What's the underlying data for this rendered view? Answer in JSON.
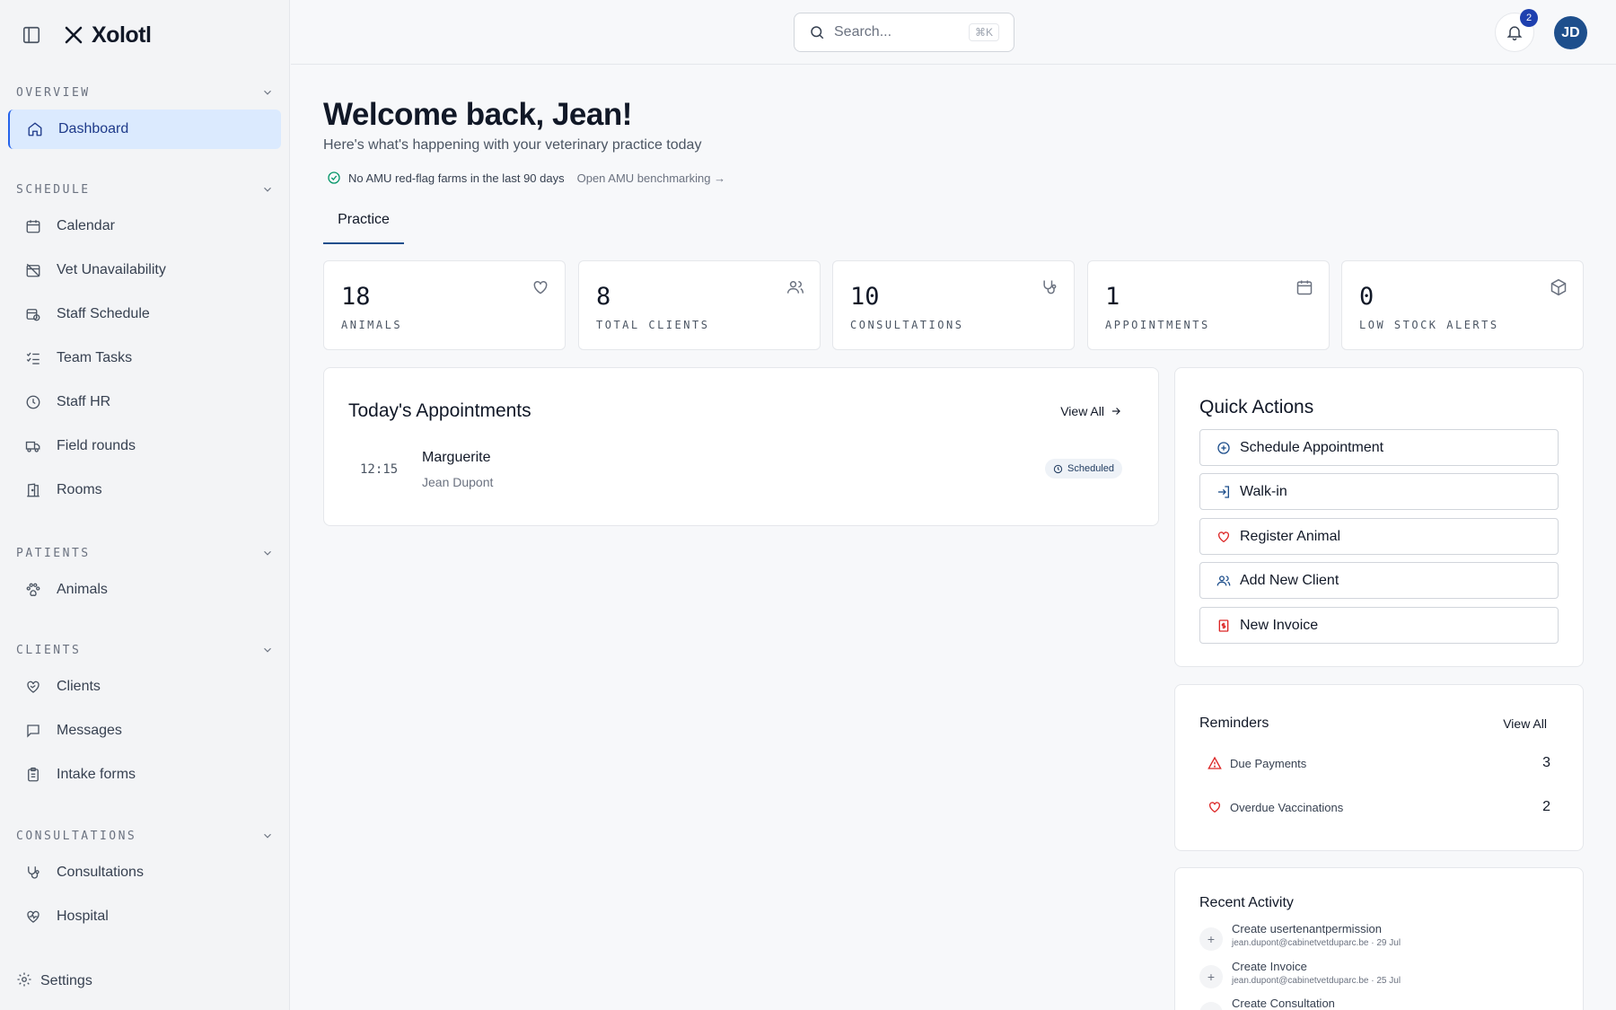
{
  "app": {
    "name": "Xolotl"
  },
  "sidebar": {
    "sections": [
      {
        "title": "OVERVIEW",
        "items": [
          {
            "label": "Dashboard",
            "icon": "home-icon",
            "active": true
          }
        ]
      },
      {
        "title": "SCHEDULE",
        "items": [
          {
            "label": "Calendar",
            "icon": "calendar-icon"
          },
          {
            "label": "Vet Unavailability",
            "icon": "calendar-off-icon"
          },
          {
            "label": "Staff Schedule",
            "icon": "calendar-clock-icon"
          },
          {
            "label": "Team Tasks",
            "icon": "list-checks-icon"
          },
          {
            "label": "Staff HR",
            "icon": "clock-icon"
          },
          {
            "label": "Field rounds",
            "icon": "truck-icon"
          },
          {
            "label": "Rooms",
            "icon": "door-icon"
          }
        ]
      },
      {
        "title": "PATIENTS",
        "items": [
          {
            "label": "Animals",
            "icon": "paw-icon"
          }
        ]
      },
      {
        "title": "CLIENTS",
        "items": [
          {
            "label": "Clients",
            "icon": "heart-handshake-icon"
          },
          {
            "label": "Messages",
            "icon": "message-square-icon"
          },
          {
            "label": "Intake forms",
            "icon": "clipboard-icon"
          }
        ]
      },
      {
        "title": "CONSULTATIONS",
        "items": [
          {
            "label": "Consultations",
            "icon": "stethoscope-icon"
          },
          {
            "label": "Hospital",
            "icon": "heart-pulse-icon"
          }
        ]
      }
    ],
    "settings_label": "Settings"
  },
  "topbar": {
    "search_placeholder": "Search...",
    "search_shortcut": "⌘K",
    "notification_count": "2",
    "avatar_initials": "JD"
  },
  "main": {
    "welcome": "Welcome back, Jean!",
    "subtitle": "Here's what's happening with your veterinary practice today",
    "amu_message": "No AMU red-flag farms in the last 90 days",
    "amu_link": "Open AMU benchmarking →",
    "tab": "Practice",
    "stats": [
      {
        "value": "18",
        "label": "ANIMALS",
        "icon": "heart-icon"
      },
      {
        "value": "8",
        "label": "TOTAL CLIENTS",
        "icon": "users-icon"
      },
      {
        "value": "10",
        "label": "CONSULTATIONS",
        "icon": "stethoscope-icon"
      },
      {
        "value": "1",
        "label": "APPOINTMENTS",
        "icon": "calendar-icon"
      },
      {
        "value": "0",
        "label": "LOW STOCK ALERTS",
        "icon": "package-icon"
      }
    ],
    "appointments": {
      "title": "Today's Appointments",
      "view_all": "View All",
      "items": [
        {
          "time": "12:15",
          "patient": "Marguerite",
          "owner": "Jean Dupont",
          "status": "Scheduled"
        }
      ]
    },
    "quick_actions": {
      "title": "Quick Actions",
      "items": [
        {
          "label": "Schedule Appointment",
          "icon": "plus-circle-icon"
        },
        {
          "label": "Walk-in",
          "icon": "log-in-icon"
        },
        {
          "label": "Register Animal",
          "icon": "heart-icon"
        },
        {
          "label": "Add New Client",
          "icon": "users-icon"
        },
        {
          "label": "New Invoice",
          "icon": "receipt-icon"
        }
      ]
    },
    "reminders": {
      "title": "Reminders",
      "view_all": "View All",
      "items": [
        {
          "label": "Due Payments",
          "count": "3",
          "icon": "alert-triangle-icon"
        },
        {
          "label": "Overdue Vaccinations",
          "count": "2",
          "icon": "heart-icon"
        }
      ]
    },
    "activity": {
      "title": "Recent Activity",
      "items": [
        {
          "action": "Create usertenantpermission",
          "meta": "jean.dupont@cabinetvetduparc.be · 29 Jul"
        },
        {
          "action": "Create Invoice",
          "meta": "jean.dupont@cabinetvetduparc.be · 25 Jul"
        },
        {
          "action": "Create Consultation",
          "meta": ""
        }
      ]
    }
  },
  "colors": {
    "accent": "#1e4f8c",
    "active_bg": "#dbeafe",
    "danger": "#dc2626"
  }
}
